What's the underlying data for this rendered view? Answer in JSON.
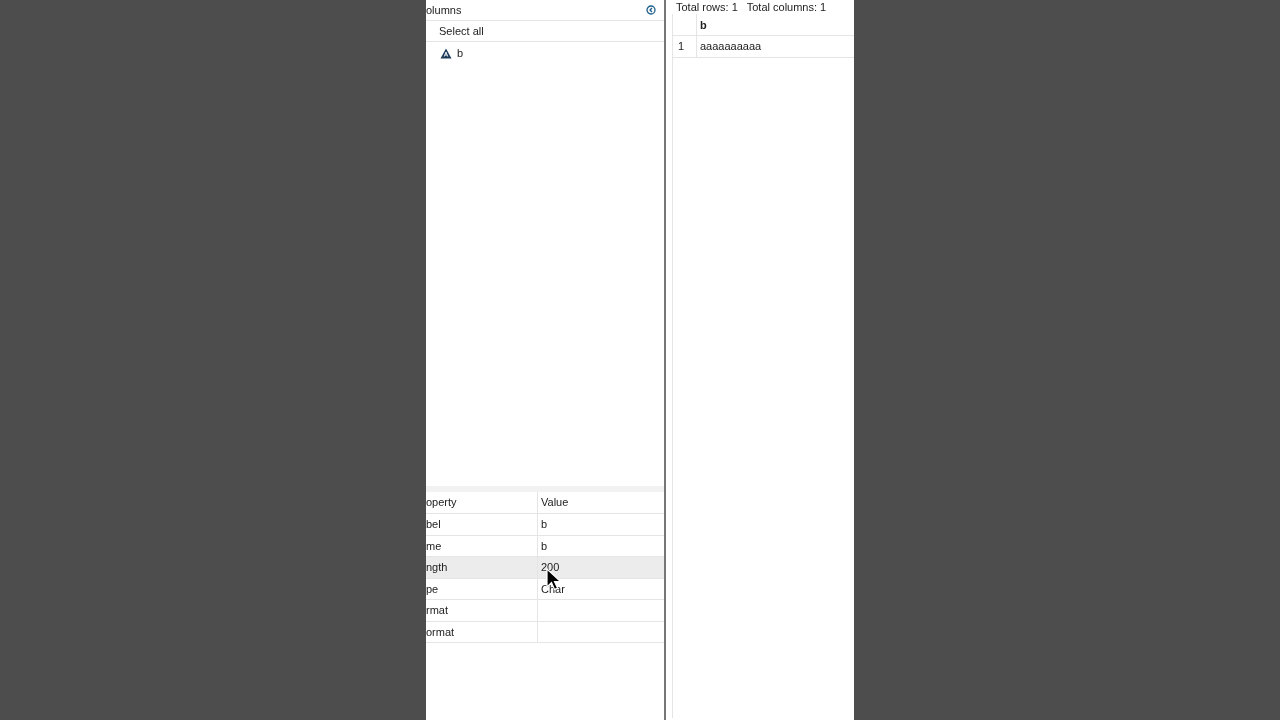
{
  "columns_panel": {
    "title": "olumns",
    "select_all": "Select all",
    "items": [
      {
        "label": "b"
      }
    ]
  },
  "properties": {
    "columns": [
      "operty",
      "Value"
    ],
    "rows": [
      {
        "property": "bel",
        "value": "b",
        "selected": false
      },
      {
        "property": "me",
        "value": "b",
        "selected": false
      },
      {
        "property": "ngth",
        "value": "200",
        "selected": true
      },
      {
        "property": "pe",
        "value": "Char",
        "selected": false
      },
      {
        "property": "rmat",
        "value": "",
        "selected": false
      },
      {
        "property": "ormat",
        "value": "",
        "selected": false
      }
    ]
  },
  "data_view": {
    "summary": "Total rows: 1   Total columns: 1",
    "columns": [
      "",
      "b"
    ],
    "rows": [
      [
        "1",
        "aaaaaaaaaa"
      ]
    ]
  }
}
